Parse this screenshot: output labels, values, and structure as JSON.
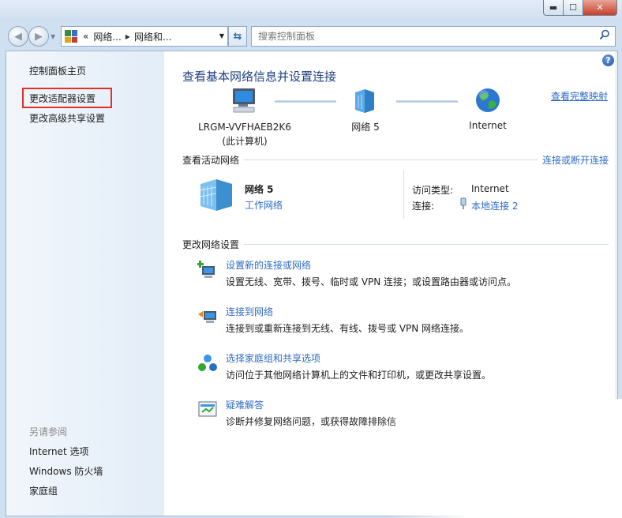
{
  "window": {
    "caption_buttons": {
      "minimize": "▬",
      "maximize": "☐",
      "close": "✕"
    }
  },
  "address_bar": {
    "overflow": "«",
    "crumbs": [
      "网络...",
      "网络和..."
    ],
    "search_placeholder": "搜索控制面板"
  },
  "sidebar": {
    "home": "控制面板主页",
    "items": [
      "更改适配器设置",
      "更改高级共享设置"
    ],
    "see_also_title": "另请参阅",
    "see_also": [
      "Internet 选项",
      "Windows 防火墙",
      "家庭组"
    ]
  },
  "main": {
    "title": "查看基本网络信息并设置连接",
    "view_full_map": "查看完整映射",
    "map": {
      "computer_name": "LRGM-VVFHAEB2K6",
      "computer_sub": "(此计算机)",
      "network": "网络  5",
      "internet": "Internet"
    },
    "active_networks": {
      "header": "查看活动网络",
      "connect_link": "连接或断开连接",
      "network_name": "网络  5",
      "network_type": "工作网络",
      "access_type_label": "访问类型:",
      "access_type_value": "Internet",
      "connections_label": "连接:",
      "connection_value": "本地连接 2"
    },
    "change_settings": {
      "header": "更改网络设置",
      "tasks": [
        {
          "title": "设置新的连接或网络",
          "desc": "设置无线、宽带、拨号、临时或 VPN 连接；或设置路由器或访问点。"
        },
        {
          "title": "连接到网络",
          "desc": "连接到或重新连接到无线、有线、拨号或 VPN 网络连接。"
        },
        {
          "title": "选择家庭组和共享选项",
          "desc": "访问位于其他网络计算机上的文件和打印机，或更改共享设置。"
        },
        {
          "title": "疑难解答",
          "desc": "诊断并修复网络问题，或获得故障排除信"
        }
      ]
    }
  },
  "colors": {
    "link": "#2e6bc4",
    "title": "#1e3f83",
    "highlight_box": "#e0302a"
  }
}
